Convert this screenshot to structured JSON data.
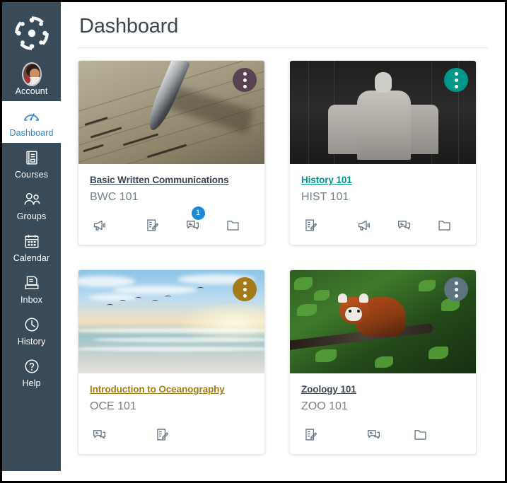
{
  "sidebar": {
    "logo_icon": "canvas-logo-icon",
    "items": [
      {
        "id": "account",
        "label": "Account",
        "icon": "user-avatar-icon",
        "active": false
      },
      {
        "id": "dashboard",
        "label": "Dashboard",
        "icon": "dashboard-gauge-icon",
        "active": true
      },
      {
        "id": "courses",
        "label": "Courses",
        "icon": "book-icon",
        "active": false
      },
      {
        "id": "groups",
        "label": "Groups",
        "icon": "people-icon",
        "active": false
      },
      {
        "id": "calendar",
        "label": "Calendar",
        "icon": "calendar-icon",
        "active": false
      },
      {
        "id": "inbox",
        "label": "Inbox",
        "icon": "inbox-tray-icon",
        "active": false
      },
      {
        "id": "history",
        "label": "History",
        "icon": "clock-icon",
        "active": false
      },
      {
        "id": "help",
        "label": "Help",
        "icon": "question-circle-icon",
        "active": false
      }
    ],
    "background_color": "#394B58",
    "active_text_color": "#2B87CE"
  },
  "header": {
    "title": "Dashboard"
  },
  "cards": [
    {
      "title": "Basic Written Communications",
      "code": "BWC 101",
      "title_color": "#3C4650",
      "accent_color": "#584150",
      "hero": "fountain-pen-on-paper",
      "menu_label": "card-options-menu",
      "actions": [
        {
          "id": "announcements",
          "icon": "megaphone-icon",
          "badge": null
        },
        {
          "id": "assignments",
          "icon": "grades-paper-pencil-icon",
          "badge": null
        },
        {
          "id": "discussions",
          "icon": "discussion-bubbles-icon",
          "badge": "1"
        },
        {
          "id": "files",
          "icon": "folder-icon",
          "badge": null
        }
      ]
    },
    {
      "title": "History 101",
      "code": "HIST 101",
      "title_color": "#009688",
      "accent_color": "#009688",
      "hero": "lincoln-memorial-bw",
      "menu_label": "card-options-menu",
      "actions": [
        {
          "id": "assignments",
          "icon": "grades-paper-pencil-icon",
          "badge": null
        },
        {
          "id": "announcements",
          "icon": "megaphone-icon",
          "badge": null
        },
        {
          "id": "discussions",
          "icon": "discussion-bubbles-icon",
          "badge": null
        },
        {
          "id": "files",
          "icon": "folder-icon",
          "badge": null
        }
      ]
    },
    {
      "title": "Introduction to Oceanography",
      "code": "OCE 101",
      "title_color": "#A57A18",
      "accent_color": "#A57A18",
      "hero": "beach-sunset-with-birds",
      "menu_label": "card-options-menu",
      "actions": [
        {
          "id": "discussions",
          "icon": "discussion-bubbles-icon",
          "badge": null
        },
        {
          "id": "assignments",
          "icon": "grades-paper-pencil-icon",
          "badge": null
        }
      ]
    },
    {
      "title": "Zoology 101",
      "code": "ZOO 101",
      "title_color": "#3C4650",
      "accent_color": "#5E7380",
      "hero": "red-panda-on-branch",
      "menu_label": "card-options-menu",
      "actions": [
        {
          "id": "assignments",
          "icon": "grades-paper-pencil-icon",
          "badge": null
        },
        {
          "id": "discussions",
          "icon": "discussion-bubbles-icon",
          "badge": null
        },
        {
          "id": "files",
          "icon": "folder-icon",
          "badge": null
        }
      ]
    }
  ],
  "colors": {
    "badge_blue": "#1C8BD6",
    "page_title": "#3C4650",
    "code_gray": "#77818A",
    "icon_gray": "#657585"
  }
}
